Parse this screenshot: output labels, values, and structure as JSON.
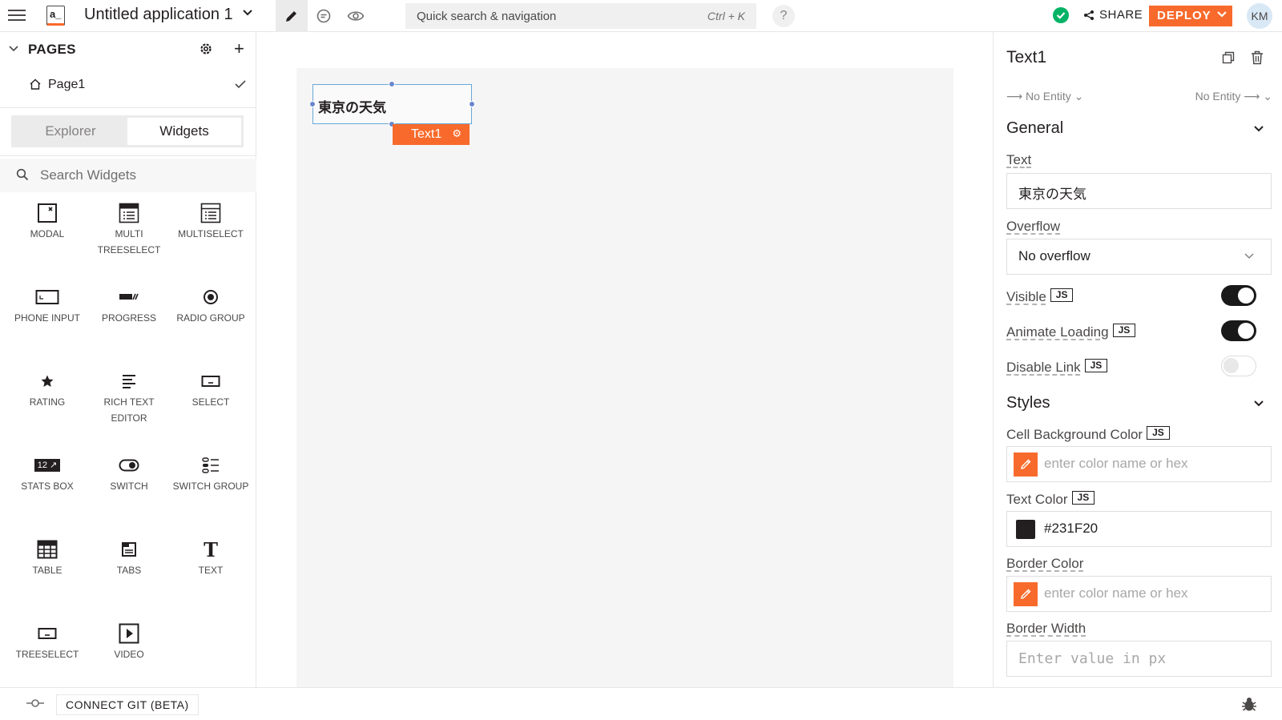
{
  "header": {
    "app_title": "Untitled application 1",
    "logo_text": "a_",
    "quick_search": {
      "placeholder": "Quick search & navigation",
      "shortcut": "Ctrl + K"
    },
    "help_label": "?",
    "share_label": "SHARE",
    "deploy_label": "DEPLOY",
    "avatar_initials": "KM",
    "accent_color": "#F86A2B",
    "status_color": "#03B365"
  },
  "pages": {
    "title": "PAGES",
    "items": [
      {
        "label": "Page1",
        "is_home": true,
        "selected": true
      }
    ]
  },
  "explorer_tabs": [
    {
      "label": "Explorer",
      "active": false
    },
    {
      "label": "Widgets",
      "active": true
    }
  ],
  "widget_search": {
    "placeholder": "Search Widgets"
  },
  "widgets": [
    {
      "label": "MODAL",
      "icon": "modal-icon"
    },
    {
      "label": "MULTI TREESELECT",
      "icon": "multi-treeselect-icon"
    },
    {
      "label": "MULTISELECT",
      "icon": "multiselect-icon"
    },
    {
      "label": "PHONE INPUT",
      "icon": "phone-input-icon"
    },
    {
      "label": "PROGRESS",
      "icon": "progress-icon"
    },
    {
      "label": "RADIO GROUP",
      "icon": "radio-group-icon"
    },
    {
      "label": "RATING",
      "icon": "rating-icon"
    },
    {
      "label": "RICH TEXT EDITOR",
      "icon": "rich-text-editor-icon"
    },
    {
      "label": "SELECT",
      "icon": "select-icon"
    },
    {
      "label": "STATS BOX",
      "icon": "stats-box-icon",
      "icon_text": "12 ↗"
    },
    {
      "label": "SWITCH",
      "icon": "switch-icon"
    },
    {
      "label": "SWITCH GROUP",
      "icon": "switch-group-icon"
    },
    {
      "label": "TABLE",
      "icon": "table-icon"
    },
    {
      "label": "TABS",
      "icon": "tabs-icon"
    },
    {
      "label": "TEXT",
      "icon": "text-icon",
      "icon_text": "T"
    },
    {
      "label": "TREESELECT",
      "icon": "treeselect-icon"
    },
    {
      "label": "VIDEO",
      "icon": "video-icon"
    }
  ],
  "canvas": {
    "text_widget": {
      "content": "東京の天気",
      "name_tag": "Text1"
    }
  },
  "properties": {
    "widget_name": "Text1",
    "entity_left": "No Entity",
    "entity_right": "No Entity",
    "general": {
      "title": "General",
      "text_label": "Text",
      "text_value": "東京の天気",
      "overflow_label": "Overflow",
      "overflow_value": "No overflow",
      "visible_label": "Visible",
      "visible": true,
      "animate_label": "Animate Loading",
      "animate": true,
      "disable_link_label": "Disable Link",
      "disable_link": false,
      "js_label": "JS"
    },
    "styles": {
      "title": "Styles",
      "cell_bg_label": "Cell Background Color",
      "cell_bg_placeholder": "enter color name or hex",
      "text_color_label": "Text Color",
      "text_color_value": "#231F20",
      "border_color_label": "Border Color",
      "border_color_placeholder": "enter color name or hex",
      "border_width_label": "Border Width",
      "border_width_placeholder": "Enter value in px"
    }
  },
  "footer": {
    "git_label": "CONNECT GIT (BETA)"
  }
}
